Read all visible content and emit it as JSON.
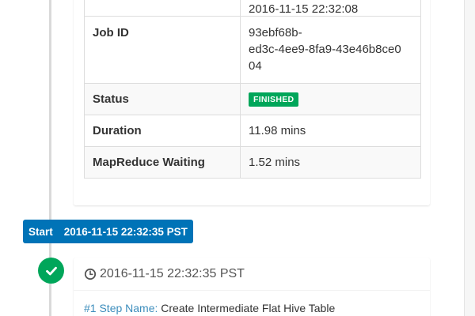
{
  "job_details": {
    "rows": [
      {
        "label": "",
        "value": "2016-11-15 22:32:08"
      },
      {
        "label": "Job ID",
        "value": "93ebf68b-\ned3c-4ee9-8fa9-43e46b8ce0\n04"
      },
      {
        "label": "Status",
        "value": "FINISHED"
      },
      {
        "label": "Duration",
        "value": "11.98 mins"
      },
      {
        "label": "MapReduce Waiting",
        "value": "1.52 mins"
      }
    ],
    "status_color": "#00a65a"
  },
  "timeline": {
    "start_label": "Start",
    "start_time": "2016-11-15 22:32:35 PST",
    "label_color": "#0073b7",
    "steps": [
      {
        "status_icon": "check-circle-icon",
        "time_icon": "clock-icon",
        "time": "2016-11-15 22:32:35 PST",
        "step_name_label": "#1 Step Name:",
        "step_name": "Create Intermediate Flat Hive Table"
      }
    ]
  }
}
